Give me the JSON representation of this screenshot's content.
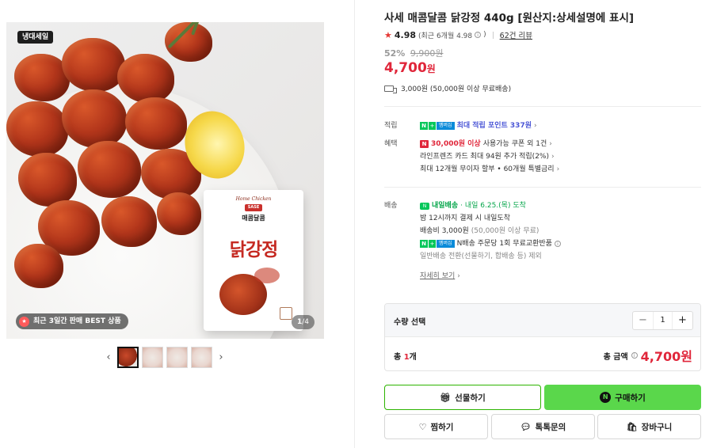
{
  "gallery": {
    "top_badge": "냉대세일",
    "best_badge": "최근 3일간 판매 BEST 상품",
    "counter_current": "1",
    "counter_total": "/4",
    "package": {
      "brand_small": "Home Chicken",
      "logo": "SASE",
      "subtitle": "매콤달콤",
      "title": "닭강정"
    }
  },
  "product": {
    "title": "사세 매콤달콤 닭강정 440g [원산지:상세설명에 표시]",
    "rating": "4.98",
    "rating_sub": "(최근 6개월 4.98",
    "review_link": "62건 리뷰",
    "discount": "52%",
    "original_price": "9,900원",
    "price": "4,700",
    "price_unit": "원",
    "shipping": "3,000원 (50,000원 이상 무료배송)"
  },
  "points": {
    "label": "적립",
    "text": "최대 적립 포인트 337원",
    "badge_n": "N",
    "badge_plus": "+",
    "badge_member": "멤버십"
  },
  "benefits": {
    "label": "혜택",
    "coupon_tag": "N",
    "coupon_amount": "30,000원 이상",
    "coupon_text": "사용가능 쿠폰 외 1건",
    "card_text": "라인프렌즈 카드 최대 94원 추가 적립(2%)",
    "installment_text": "최대 12개월 무이자 할부 • 60개월 특별금리"
  },
  "delivery": {
    "label": "배송",
    "today_icon": "N",
    "express": "내일배송",
    "eta": "· 내일 6.25.(목) 도착",
    "cutoff": "밤 12시까지 결제 시 내일도착",
    "fee": "배송비 3,000원",
    "fee_note": "(50,000원 이상 무료)",
    "return_text": "N배송 주문당 1회 무료교환반품",
    "normal_text": "일반배송 전환(선물하기, 합배송 등) 제외",
    "more_link": "자세히 보기"
  },
  "quantity": {
    "label": "수량 선택",
    "minus": "−",
    "value": "1",
    "plus": "+",
    "total_prefix": "총 ",
    "total_count": "1",
    "total_suffix": "개",
    "total_label": "총 금액",
    "total_price": "4,700원"
  },
  "buttons": {
    "gift": "선물하기",
    "buy": "구매하기",
    "buy_n": "N",
    "wish": "찜하기",
    "talk": "톡톡문의",
    "cart": "장바구니"
  },
  "colors": {
    "price_red": "#e0263a",
    "naver_green": "#03c75a",
    "buy_button": "#5ad74b",
    "point_blue": "#4b56d6"
  }
}
